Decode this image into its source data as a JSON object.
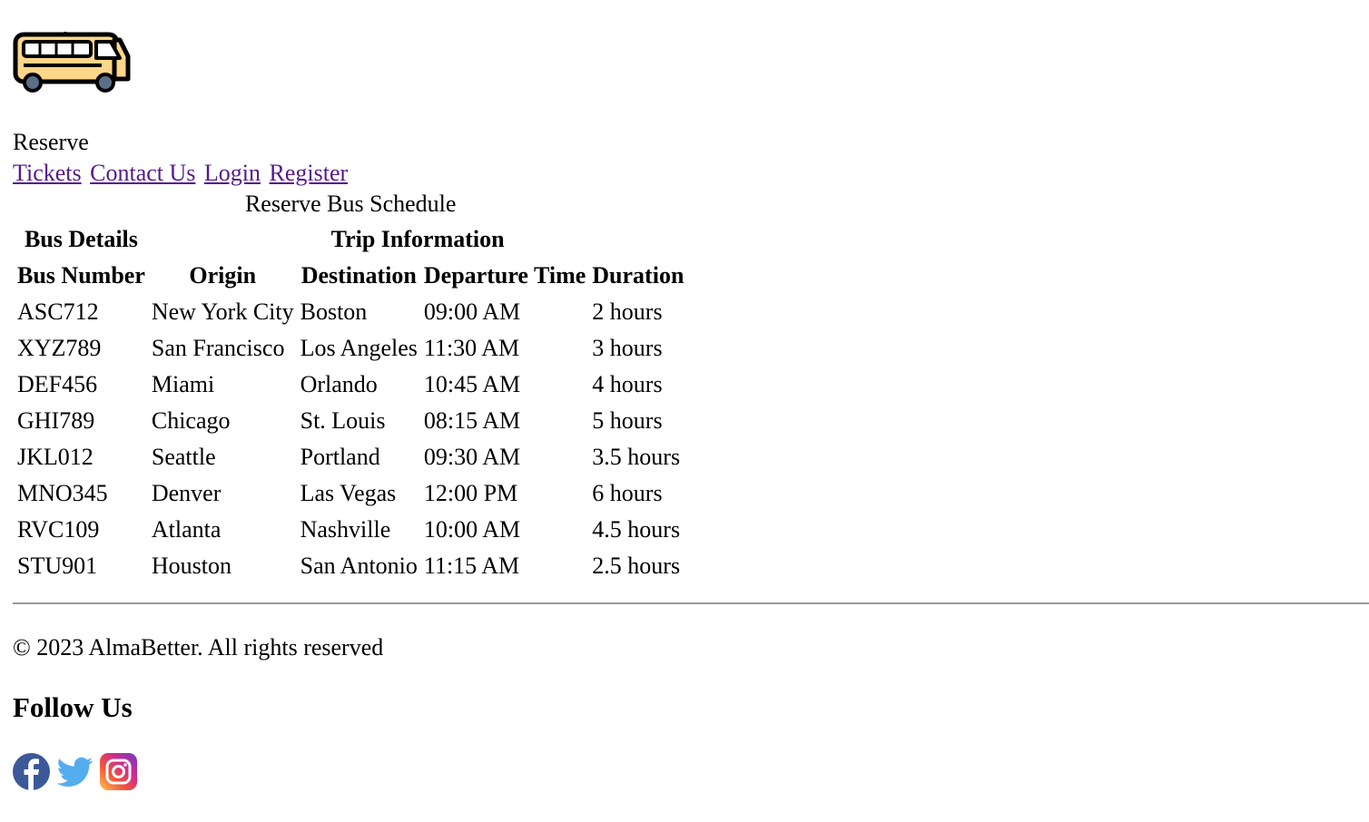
{
  "header": {
    "logo_icon": "bus-icon",
    "brand_label": "Reserve",
    "nav": {
      "tickets": "Tickets",
      "contact": "Contact Us",
      "login": "Login",
      "register": "Register"
    }
  },
  "schedule": {
    "caption": "Reserve Bus Schedule",
    "group_headers": {
      "bus_details": "Bus Details",
      "trip_information": "Trip Information"
    },
    "columns": {
      "bus_number": "Bus Number",
      "origin": "Origin",
      "destination": "Destination",
      "departure_time": "Departure Time",
      "duration": "Duration"
    },
    "rows": [
      {
        "bus_number": "ASC712",
        "origin": "New York City",
        "destination": "Boston",
        "departure_time": "09:00 AM",
        "duration": "2 hours"
      },
      {
        "bus_number": "XYZ789",
        "origin": "San Francisco",
        "destination": "Los Angeles",
        "departure_time": "11:30 AM",
        "duration": "3 hours"
      },
      {
        "bus_number": "DEF456",
        "origin": "Miami",
        "destination": "Orlando",
        "departure_time": "10:45 AM",
        "duration": "4 hours"
      },
      {
        "bus_number": "GHI789",
        "origin": "Chicago",
        "destination": "St. Louis",
        "departure_time": "08:15 AM",
        "duration": "5 hours"
      },
      {
        "bus_number": "JKL012",
        "origin": "Seattle",
        "destination": "Portland",
        "departure_time": "09:30 AM",
        "duration": "3.5 hours"
      },
      {
        "bus_number": "MNO345",
        "origin": "Denver",
        "destination": "Las Vegas",
        "departure_time": "12:00 PM",
        "duration": "6 hours"
      },
      {
        "bus_number": "RVC109",
        "origin": "Atlanta",
        "destination": "Nashville",
        "departure_time": "10:00 AM",
        "duration": "4.5 hours"
      },
      {
        "bus_number": "STU901",
        "origin": "Houston",
        "destination": "San Antonio",
        "departure_time": "11:15 AM",
        "duration": "2.5 hours"
      }
    ]
  },
  "footer": {
    "copyright": "© 2023 AlmaBetter. All rights reserved",
    "follow_heading": "Follow Us",
    "social_icons": [
      "facebook-icon",
      "twitter-icon",
      "instagram-icon"
    ]
  },
  "colors": {
    "link_visited": "#551a8b",
    "bus_body": "#fdd68a",
    "facebook": "#3b5998",
    "twitter": "#55acee"
  }
}
